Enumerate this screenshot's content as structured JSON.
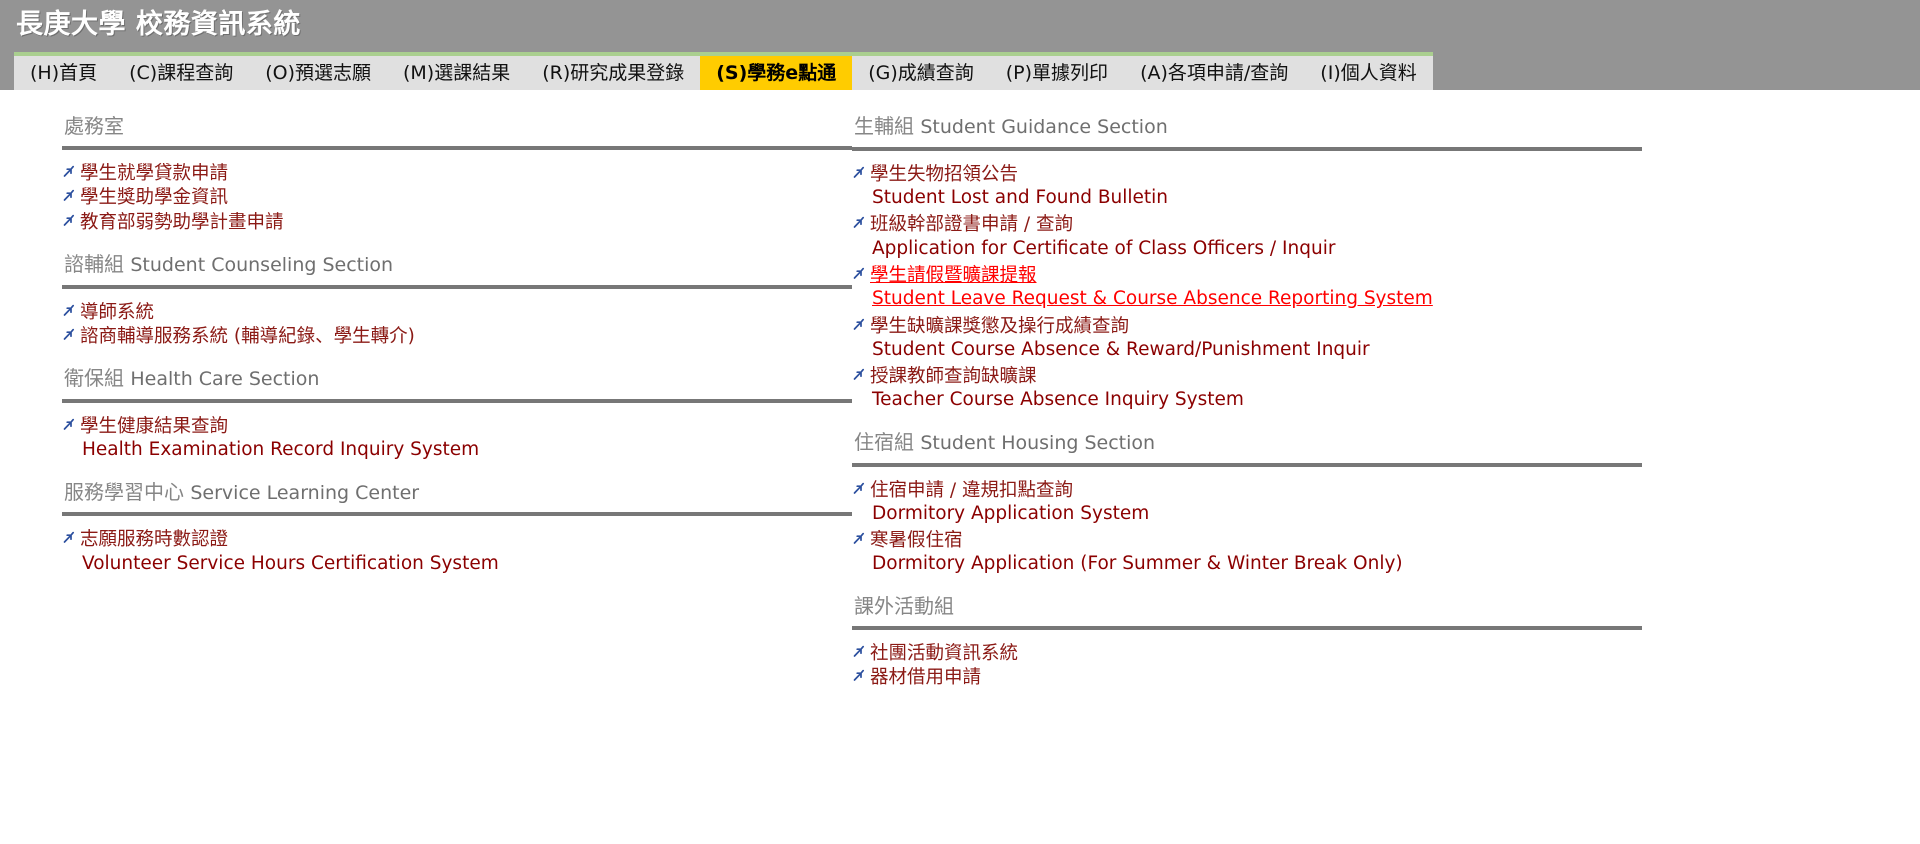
{
  "header": {
    "title": "長庚大學 校務資訊系統",
    "background_color": "#949494",
    "title_color": "#ffffff"
  },
  "nav": {
    "accent_top_border": "#aacf8f",
    "bar_background": "#e0e0e0",
    "active_background": "#ffcc00",
    "items": [
      {
        "label": "(H)首頁",
        "active": false
      },
      {
        "label": "(C)課程查詢",
        "active": false
      },
      {
        "label": "(O)預選志願",
        "active": false
      },
      {
        "label": "(M)選課結果",
        "active": false
      },
      {
        "label": "(R)研究成果登錄",
        "active": false
      },
      {
        "label": "(S)學務e點通",
        "active": true
      },
      {
        "label": "(G)成績查詢",
        "active": false
      },
      {
        "label": "(P)單據列印",
        "active": false
      },
      {
        "label": "(A)各項申請/查詢",
        "active": false
      },
      {
        "label": "(I)個人資料",
        "active": false
      }
    ]
  },
  "colors": {
    "heading": "#7a7a7a",
    "rule": "#777777",
    "link": "#8b1a15",
    "link_en": "#8b0000",
    "link_hover": "#ff0000",
    "arrow": "#2b4f9e"
  },
  "left_column": [
    {
      "heading_zh": "處務室",
      "heading_en": "",
      "links": [
        {
          "zh": "學生就學貸款申請",
          "en": "",
          "hovered": false
        },
        {
          "zh": "學生獎助學金資訊",
          "en": "",
          "hovered": false
        },
        {
          "zh": "教育部弱勢助學計畫申請",
          "en": "",
          "hovered": false
        }
      ]
    },
    {
      "heading_zh": "諮輔組",
      "heading_en": "Student Counseling Section",
      "links": [
        {
          "zh": "導師系統",
          "en": "",
          "hovered": false
        },
        {
          "zh": "諮商輔導服務系統 (輔導紀錄、學生轉介)",
          "en": "",
          "hovered": false
        }
      ]
    },
    {
      "heading_zh": "衛保組",
      "heading_en": "Health Care Section",
      "links": [
        {
          "zh": "學生健康結果查詢",
          "en": "Health Examination Record Inquiry System",
          "hovered": false
        }
      ]
    },
    {
      "heading_zh": "服務學習中心",
      "heading_en": "Service Learning Center",
      "links": [
        {
          "zh": "志願服務時數認證",
          "en": "Volunteer Service Hours Certification System",
          "hovered": false
        }
      ]
    }
  ],
  "right_column": [
    {
      "heading_zh": "生輔組",
      "heading_en": "Student Guidance Section",
      "links": [
        {
          "zh": "學生失物招領公告",
          "en": "Student Lost and Found Bulletin",
          "hovered": false
        },
        {
          "zh": "班級幹部證書申請 / 查詢",
          "en": "Application for Certificate of Class Officers / Inquir",
          "hovered": false
        },
        {
          "zh": "學生請假暨曠課提報",
          "en": "Student Leave Request & Course Absence Reporting System",
          "hovered": true
        },
        {
          "zh": "學生缺曠課獎懲及操行成績查詢",
          "en": "Student Course Absence & Reward/Punishment Inquir",
          "hovered": false
        },
        {
          "zh": "授課教師查詢缺曠課",
          "en": "Teacher Course Absence Inquiry System",
          "hovered": false
        }
      ]
    },
    {
      "heading_zh": "住宿組",
      "heading_en": "Student Housing Section",
      "links": [
        {
          "zh": "住宿申請 / 違規扣點查詢",
          "en": "Dormitory Application System",
          "hovered": false
        },
        {
          "zh": "寒暑假住宿",
          "en": "Dormitory Application (For Summer & Winter Break Only)",
          "hovered": false
        }
      ]
    },
    {
      "heading_zh": "課外活動組",
      "heading_en": "",
      "links": [
        {
          "zh": "社團活動資訊系統",
          "en": "",
          "hovered": false
        },
        {
          "zh": "器材借用申請",
          "en": "",
          "hovered": false
        }
      ]
    }
  ]
}
